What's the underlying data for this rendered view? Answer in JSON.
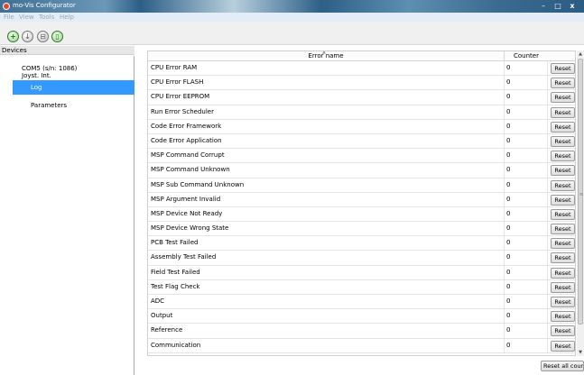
{
  "window": {
    "title": "mo-Vis Configurator",
    "min_label": "–",
    "max_label": "□",
    "close_label": "x"
  },
  "menu": {
    "file": "File",
    "view": "View",
    "tools": "Tools",
    "help": "Help"
  },
  "toolbar": {
    "add": "+",
    "download": "↓",
    "save": "⊟",
    "doc": "▯"
  },
  "devices": {
    "header": "Devices",
    "device_line1": "COM5 (s/n: 1086)",
    "device_line2": "Joyst. Int.",
    "items": [
      {
        "label": "Log",
        "selected": true
      },
      {
        "label": "Parameters",
        "selected": false
      }
    ]
  },
  "table": {
    "col_error": "Error name",
    "col_counter": "Counter",
    "reset_label": "Reset",
    "rows": [
      {
        "name": "CPU Error RAM",
        "counter": "0"
      },
      {
        "name": "CPU Error FLASH",
        "counter": "0"
      },
      {
        "name": "CPU Error EEPROM",
        "counter": "0"
      },
      {
        "name": "Run Error Scheduler",
        "counter": "0"
      },
      {
        "name": "Code Error Framework",
        "counter": "0"
      },
      {
        "name": "Code Error Application",
        "counter": "0"
      },
      {
        "name": "MSP Command Corrupt",
        "counter": "0"
      },
      {
        "name": "MSP Command Unknown",
        "counter": "0"
      },
      {
        "name": "MSP Sub Command Unknown",
        "counter": "0"
      },
      {
        "name": "MSP Argument Invalid",
        "counter": "0"
      },
      {
        "name": "MSP Device Not Ready",
        "counter": "0"
      },
      {
        "name": "MSP Device Wrong State",
        "counter": "0"
      },
      {
        "name": "PCB Test Failed",
        "counter": "0"
      },
      {
        "name": "Assembly Test Failed",
        "counter": "0"
      },
      {
        "name": "Field Test Failed",
        "counter": "0"
      },
      {
        "name": "Test Flag Check",
        "counter": "0"
      },
      {
        "name": "ADC",
        "counter": "0"
      },
      {
        "name": "Output",
        "counter": "0"
      },
      {
        "name": "Reference",
        "counter": "0"
      },
      {
        "name": "Communication",
        "counter": "0"
      }
    ]
  },
  "footer": {
    "reset_all_label": "Reset all counters"
  },
  "colors": {
    "selection": "#3399ff",
    "title_bar": "#2c5e86"
  }
}
